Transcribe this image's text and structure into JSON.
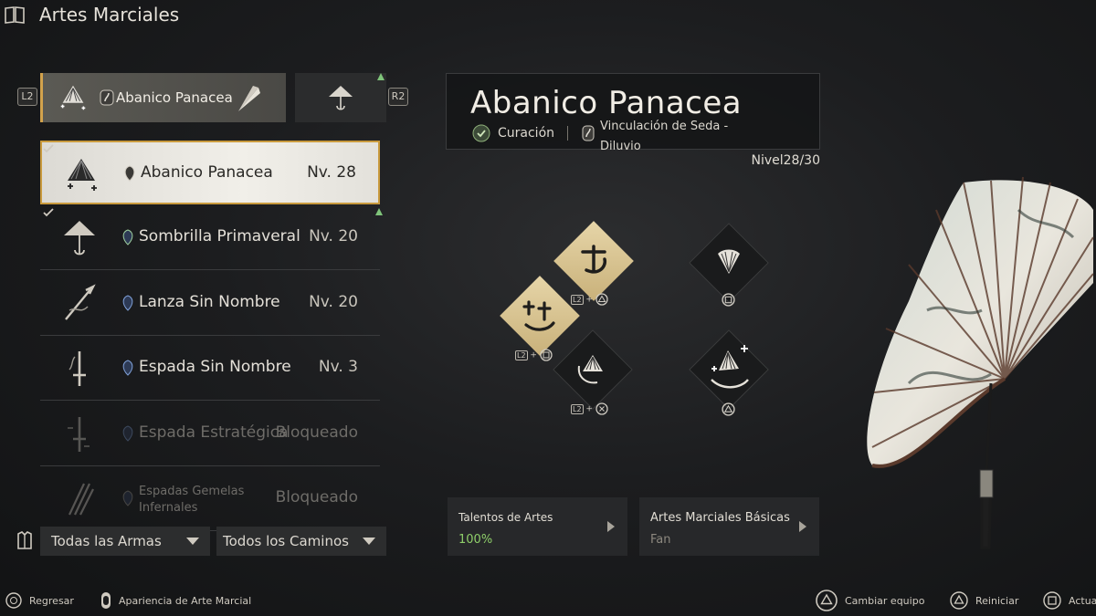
{
  "header": {
    "title": "Artes Marciales",
    "icon": "book-icon"
  },
  "selector": {
    "left_shoulder": "L2",
    "right_shoulder": "R2",
    "equipped_name": "Abanico Panacea",
    "accent": "#d2a24c"
  },
  "weapons": [
    {
      "name": "Abanico Panacea",
      "level": "Nv. 28",
      "icon": "fan-icon",
      "state": "selected"
    },
    {
      "name": "Sombrilla Primaveral",
      "level": "Nv. 20",
      "icon": "umbrella-icon",
      "state": "normal"
    },
    {
      "name": "Lanza Sin Nombre",
      "level": "Nv. 20",
      "icon": "spear-icon",
      "state": "normal"
    },
    {
      "name": "Espada Sin Nombre",
      "level": "Nv. 3",
      "icon": "sword-icon",
      "state": "normal"
    },
    {
      "name": "Espada Estratégica",
      "level": "Bloqueado",
      "icon": "strategic-sword-icon",
      "state": "locked"
    },
    {
      "name": "Espadas Gemelas Infernales",
      "level": "Bloqueado",
      "icon": "twin-swords-icon",
      "state": "locked"
    }
  ],
  "filters": {
    "weapons": "Todas las Armas",
    "paths": "Todos los Caminos"
  },
  "detail": {
    "name": "Abanico Panacea",
    "role": "Curación",
    "path": "Vinculación de Seda - Diluvio",
    "level_label": "Nivel",
    "level_value": "28/30"
  },
  "skills": {
    "combo_labels": {
      "l2": "L2",
      "plus": "+"
    }
  },
  "cards": {
    "talents_title": "Talentos de Artes",
    "talents_value": "100%",
    "talents_color": "#8fcf6a",
    "basic_title": "Artes Marciales Básicas",
    "basic_value": "Fan"
  },
  "hints": {
    "back": "Regresar",
    "appearance": "Apariencia de Arte Marcial",
    "change": "Cambiar equipo",
    "reset": "Reiniciar",
    "update": "Actual"
  }
}
